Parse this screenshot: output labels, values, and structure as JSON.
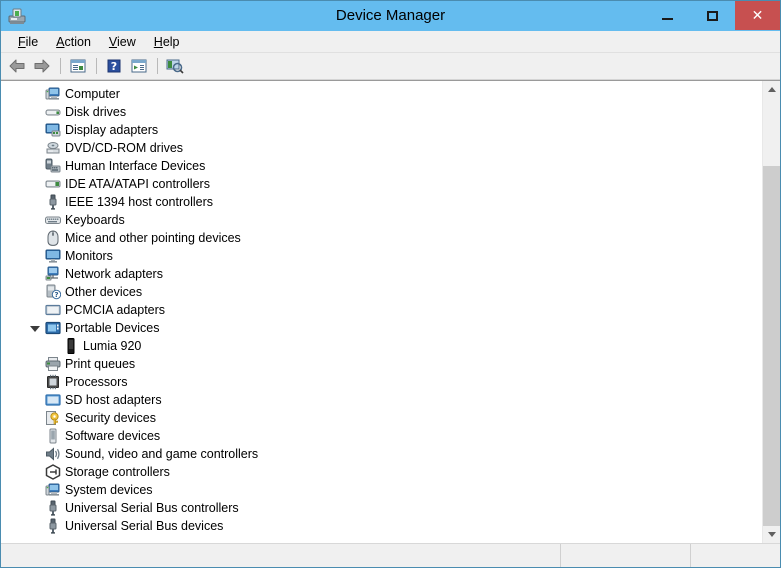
{
  "window": {
    "title": "Device Manager",
    "icon": "device-manager-icon",
    "accent_title_bar": "#64bcef",
    "border_color": "#4a8cb0",
    "close_button_color": "#c75050",
    "controls": {
      "minimize": "minimize-icon",
      "maximize": "maximize-icon",
      "close": "✕"
    }
  },
  "menu": {
    "items": [
      {
        "label": "File",
        "accel": "F"
      },
      {
        "label": "Action",
        "accel": "A"
      },
      {
        "label": "View",
        "accel": "V"
      },
      {
        "label": "Help",
        "accel": "H"
      }
    ]
  },
  "toolbar": {
    "buttons": [
      {
        "name": "back-button",
        "icon": "left-arrow-icon"
      },
      {
        "name": "forward-button",
        "icon": "right-arrow-icon"
      },
      {
        "name": "separator-1",
        "icon": "separator"
      },
      {
        "name": "show-hide-console-tree",
        "icon": "console-tree-icon"
      },
      {
        "name": "separator-2",
        "icon": "separator"
      },
      {
        "name": "help-button",
        "icon": "help-question-icon"
      },
      {
        "name": "properties-button",
        "icon": "properties-icon"
      },
      {
        "name": "separator-3",
        "icon": "separator"
      },
      {
        "name": "scan-hardware-changes",
        "icon": "scan-hardware-icon"
      }
    ]
  },
  "tree": {
    "items": [
      {
        "label": "Computer",
        "icon": "computer-icon",
        "state": "collapsed",
        "level": 0
      },
      {
        "label": "Disk drives",
        "icon": "disk-drive-icon",
        "state": "collapsed",
        "level": 0
      },
      {
        "label": "Display adapters",
        "icon": "display-adapter-icon",
        "state": "collapsed",
        "level": 0
      },
      {
        "label": "DVD/CD-ROM drives",
        "icon": "dvd-drive-icon",
        "state": "collapsed",
        "level": 0
      },
      {
        "label": "Human Interface Devices",
        "icon": "hid-icon",
        "state": "collapsed",
        "level": 0
      },
      {
        "label": "IDE ATA/ATAPI controllers",
        "icon": "ide-controller-icon",
        "state": "collapsed",
        "level": 0
      },
      {
        "label": "IEEE 1394 host controllers",
        "icon": "ieee1394-icon",
        "state": "collapsed",
        "level": 0
      },
      {
        "label": "Keyboards",
        "icon": "keyboard-icon",
        "state": "collapsed",
        "level": 0
      },
      {
        "label": "Mice and other pointing devices",
        "icon": "mouse-icon",
        "state": "collapsed",
        "level": 0
      },
      {
        "label": "Monitors",
        "icon": "monitor-icon",
        "state": "collapsed",
        "level": 0
      },
      {
        "label": "Network adapters",
        "icon": "network-adapter-icon",
        "state": "collapsed",
        "level": 0
      },
      {
        "label": "Other devices",
        "icon": "other-device-icon",
        "state": "collapsed",
        "level": 0
      },
      {
        "label": "PCMCIA adapters",
        "icon": "pcmcia-icon",
        "state": "collapsed",
        "level": 0
      },
      {
        "label": "Portable Devices",
        "icon": "portable-device-icon",
        "state": "expanded",
        "level": 0
      },
      {
        "label": "Lumia 920",
        "icon": "phone-icon",
        "state": "leaf",
        "level": 1
      },
      {
        "label": "Print queues",
        "icon": "printer-icon",
        "state": "collapsed",
        "level": 0
      },
      {
        "label": "Processors",
        "icon": "processor-icon",
        "state": "collapsed",
        "level": 0
      },
      {
        "label": "SD host adapters",
        "icon": "sd-host-icon",
        "state": "collapsed",
        "level": 0
      },
      {
        "label": "Security devices",
        "icon": "security-key-icon",
        "state": "collapsed",
        "level": 0
      },
      {
        "label": "Software devices",
        "icon": "software-device-icon",
        "state": "collapsed",
        "level": 0
      },
      {
        "label": "Sound, video and game controllers",
        "icon": "speaker-icon",
        "state": "collapsed",
        "level": 0
      },
      {
        "label": "Storage controllers",
        "icon": "storage-controller-icon",
        "state": "collapsed",
        "level": 0
      },
      {
        "label": "System devices",
        "icon": "system-device-icon",
        "state": "collapsed",
        "level": 0
      },
      {
        "label": "Universal Serial Bus controllers",
        "icon": "usb-icon",
        "state": "collapsed",
        "level": 0
      },
      {
        "label": "Universal Serial Bus devices",
        "icon": "usb-icon",
        "state": "collapsed",
        "level": 0
      }
    ]
  },
  "scrollbar": {
    "up_arrow": "scroll-up-icon",
    "down_arrow": "scroll-down-icon"
  },
  "statusbar": {
    "main": "",
    "middle": "",
    "end": ""
  }
}
